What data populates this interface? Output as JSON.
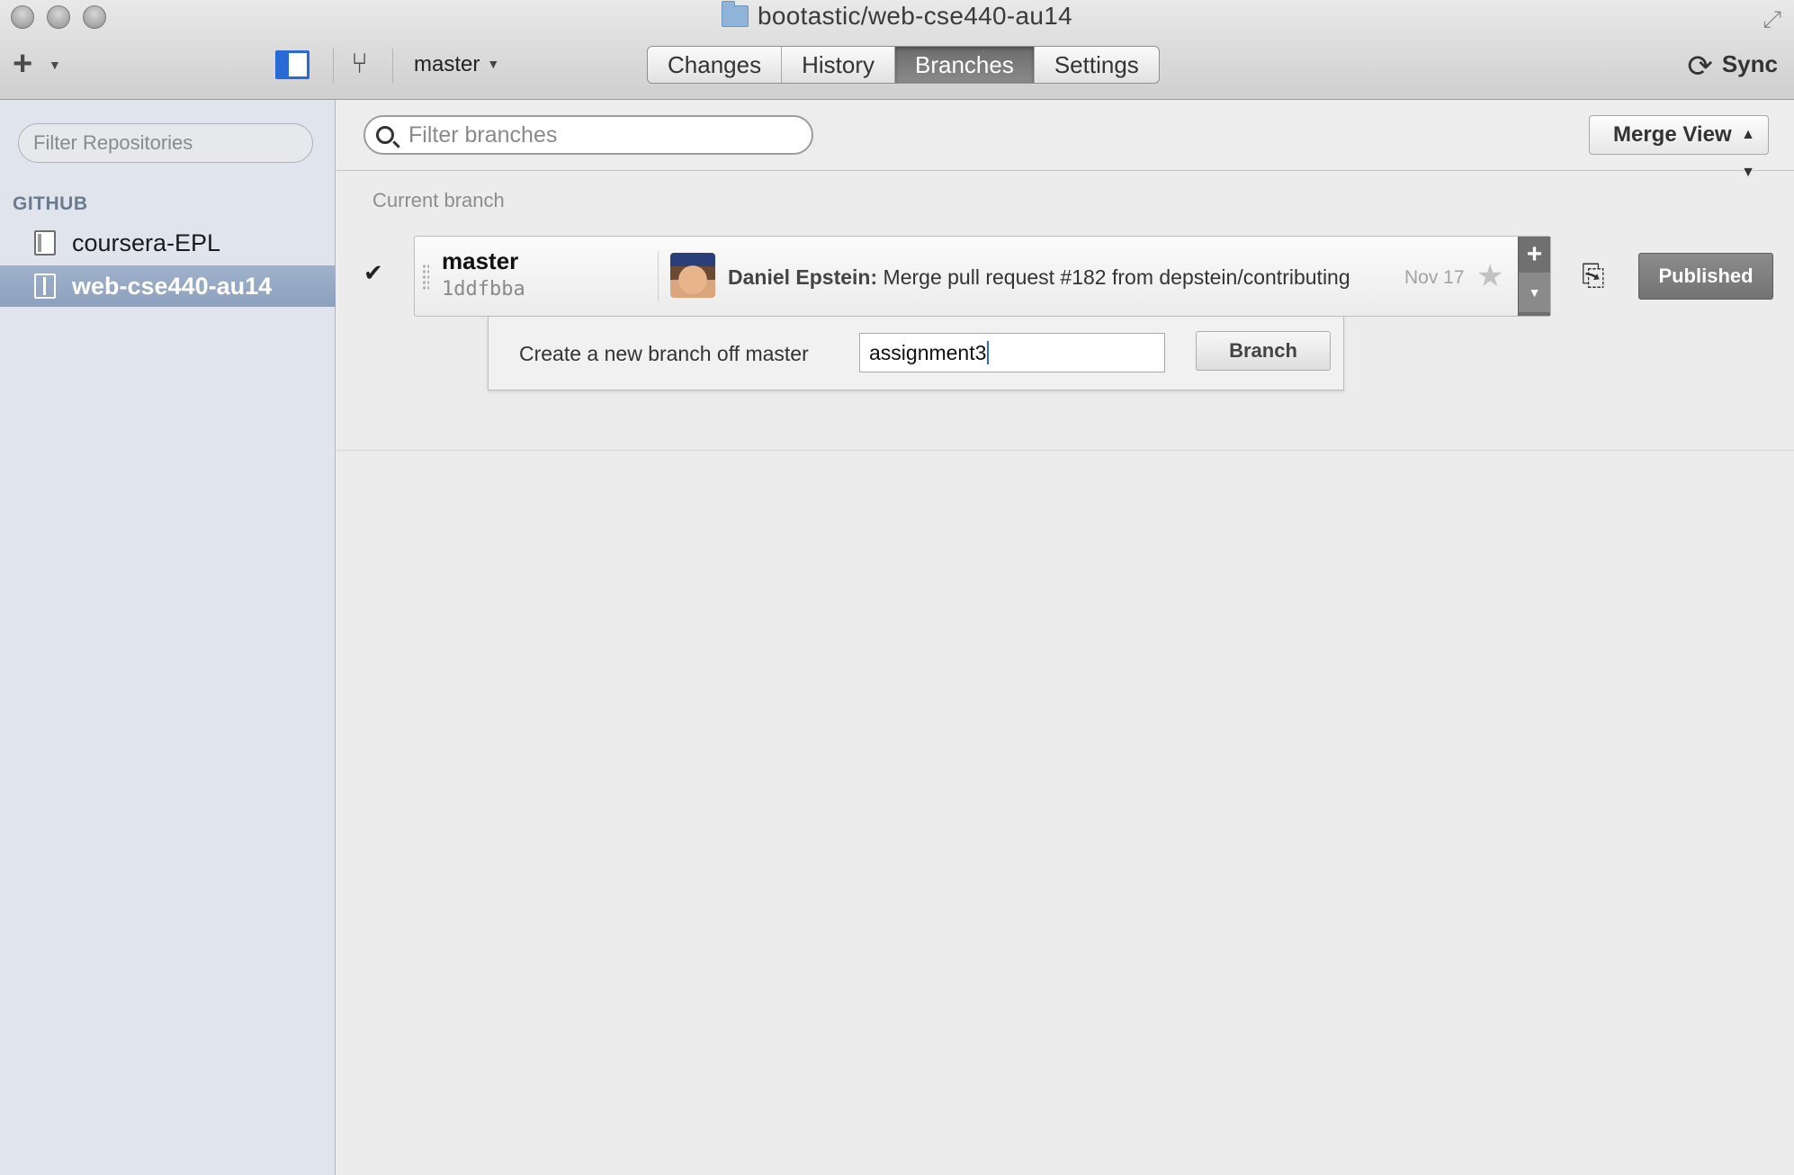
{
  "window": {
    "title": "bootastic/web-cse440-au14"
  },
  "toolbar": {
    "branch_selector": "master",
    "tabs": [
      {
        "label": "Changes",
        "active": false
      },
      {
        "label": "History",
        "active": false
      },
      {
        "label": "Branches",
        "active": true
      },
      {
        "label": "Settings",
        "active": false
      }
    ],
    "sync_label": "Sync"
  },
  "sidebar": {
    "filter_placeholder": "Filter Repositories",
    "section_label": "GITHUB",
    "repos": [
      {
        "name": "coursera-EPL",
        "selected": false
      },
      {
        "name": "web-cse440-au14",
        "selected": true
      }
    ]
  },
  "main": {
    "filter_placeholder": "Filter branches",
    "merge_view_label": "Merge View",
    "current_branch_label": "Current branch",
    "current_branch": {
      "name": "master",
      "sha": "1ddfbba",
      "author": "Daniel Epstein:",
      "message": "Merge pull request #182 from depstein/contributing",
      "date": "Nov 17",
      "status": "Published"
    },
    "new_branch": {
      "label": "Create a new branch off master",
      "value": "assignment3",
      "button": "Branch"
    }
  },
  "colors": {
    "accent": "#2a6ad6",
    "sidebar_bg": "#e0e4ec",
    "selected_repo": "#8da1bd",
    "active_tab": "#7a7a7a"
  }
}
